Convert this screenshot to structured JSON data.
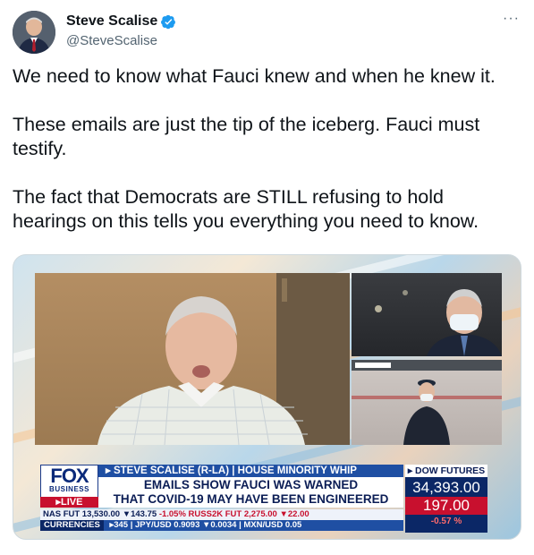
{
  "tweet": {
    "display_name": "Steve Scalise",
    "handle": "@SteveScalise",
    "verified_icon": "verified-badge-icon",
    "more_icon": "more-options-icon",
    "more_label": "···",
    "paragraphs": [
      "We need to know what Fauci knew and when he knew it.",
      "These emails are just the tip of the iceberg. Fauci must testify.",
      "The fact that Democrats are STILL refusing to hold hearings on this tells you everything you need to know."
    ]
  },
  "media": {
    "network_logo": "FOX",
    "network_sub": "BUSINESS",
    "live_label": "▸LIVE",
    "kicker": "▸ STEVE SCALISE (R-LA) | HOUSE MINORITY WHIP",
    "headline_line1": "EMAILS SHOW FAUCI WAS WARNED",
    "headline_line2": "THAT COVID-19 MAY HAVE BEEN ENGINEERED",
    "futures_label": "▸ DOW FUTURES",
    "futures_value": "34,393.00",
    "futures_change": "197.00",
    "futures_percent": "-0.57 %",
    "ticker_line1": "NAS FUT  13,530.00 ▼143.75",
    "ticker_line1_extra": "-1.05%  RUSS2K FUT  2,275.00 ▼22.00",
    "ticker_currencies": "CURRENCIES",
    "ticker_line2": "▸345  |  JPY/USD  0.9093  ▼0.0034  |  MXN/USD  0.05",
    "colors": {
      "fox_blue": "#1f4fa3",
      "fox_red": "#c8102e",
      "navy": "#0b2766"
    }
  }
}
